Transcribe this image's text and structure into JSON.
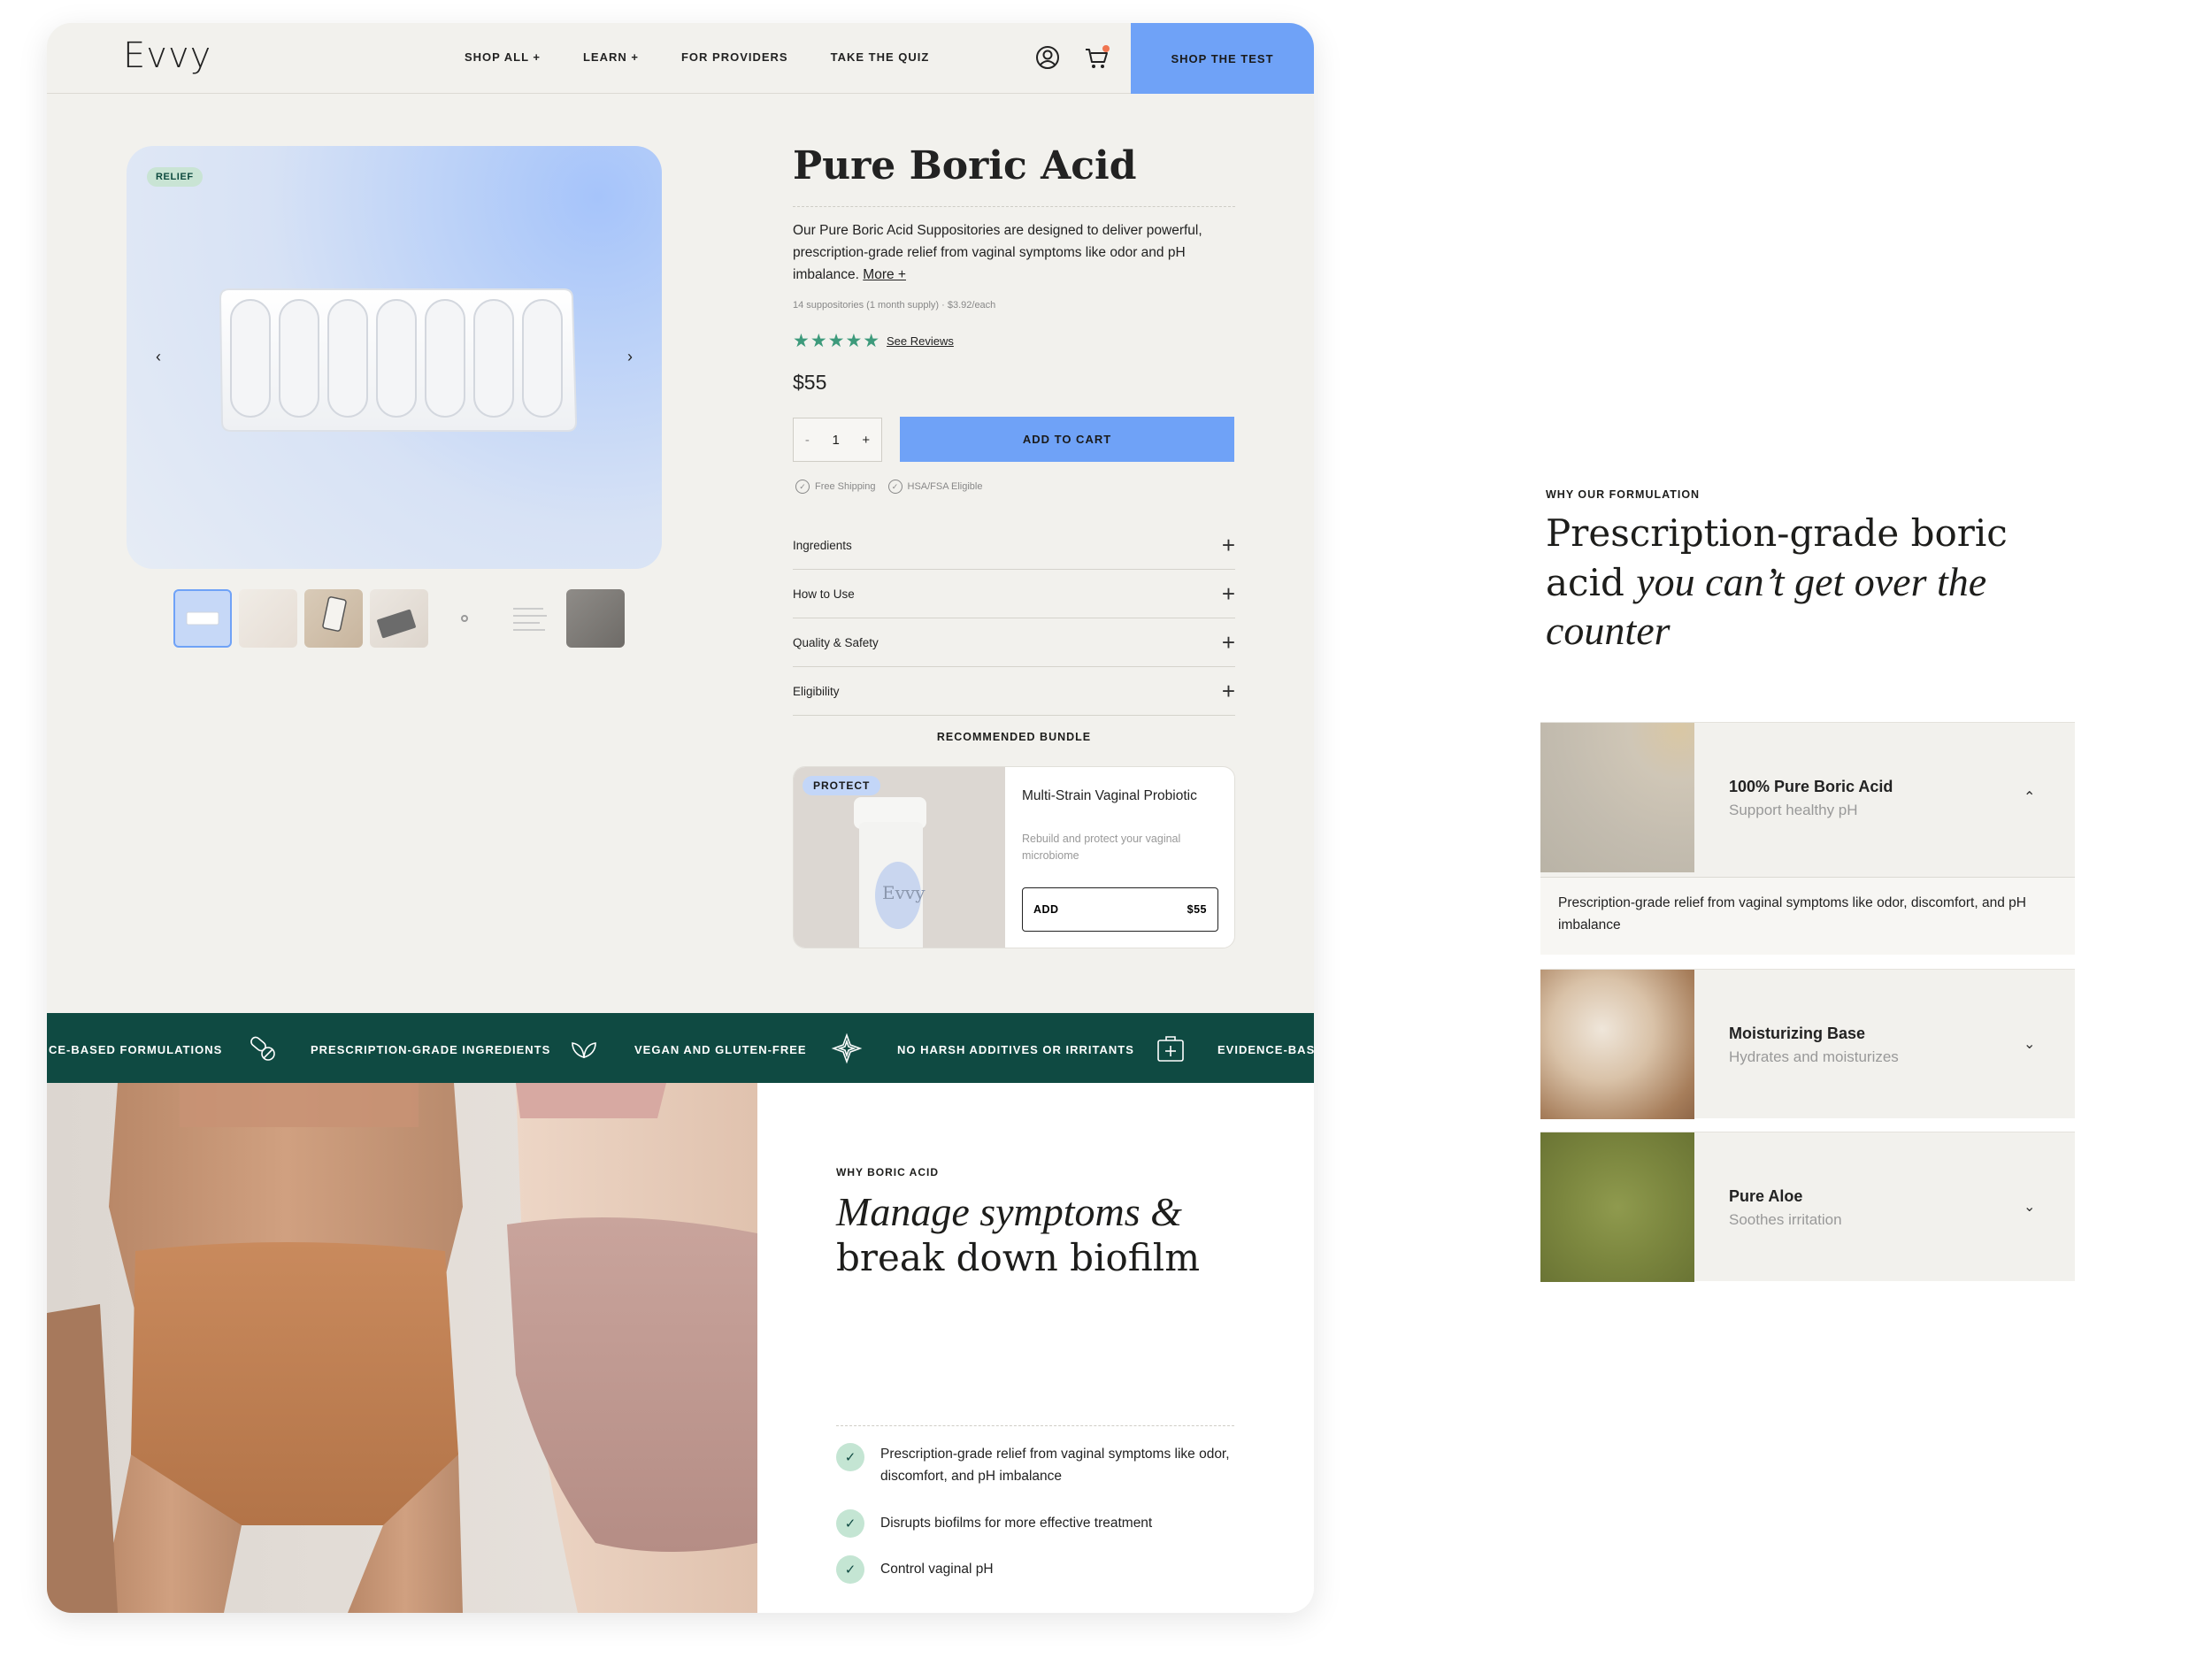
{
  "nav": {
    "logo": "Evvy",
    "links": [
      "SHOP ALL +",
      "LEARN +",
      "FOR PROVIDERS",
      "TAKE THE QUIZ"
    ],
    "cta": "SHOP THE TEST"
  },
  "gallery": {
    "badge": "RELIEF"
  },
  "product": {
    "title": "Pure Boric Acid",
    "description": "Our Pure Boric Acid Suppositories are designed to deliver powerful, prescription-grade relief from vaginal symptoms like odor and pH imbalance.",
    "more_link": "More +",
    "supply": "14 suppositories (1 month supply) · $3.92/each",
    "stars": "★★★★★",
    "rating": 5,
    "reviews_link": "See Reviews",
    "price": "$55",
    "qty_minus": "-",
    "qty_value": "1",
    "qty_plus": "+",
    "add_to_cart": "ADD TO CART",
    "perks": [
      "Free Shipping",
      "HSA/FSA Eligible"
    ]
  },
  "accordion": [
    "Ingredients",
    "How to Use",
    "Quality & Safety",
    "Eligibility"
  ],
  "bundle": {
    "title": "RECOMMENDED BUNDLE",
    "badge": "PROTECT",
    "bottle_label": "Evvy",
    "name": "Multi-Strain Vaginal Probiotic",
    "desc": "Rebuild and protect your vaginal microbiome",
    "add_label": "ADD",
    "add_price": "$55"
  },
  "marquee": [
    "CE-BASED  FORMULATIONS",
    "PRESCRIPTION-GRADE  INGREDIENTS",
    "VEGAN AND  GLUTEN-FREE",
    "NO HARSH ADDITIVES  OR IRRITANTS",
    "EVIDENCE-BASE"
  ],
  "why": {
    "eyebrow": "WHY BORIC ACID",
    "head_italic": "Manage symptoms &",
    "head_regular": "break down biofilm",
    "benefits": [
      "Prescription-grade relief from vaginal symptoms like odor, discomfort, and pH imbalance",
      "Disrupts biofilms for more effective treatment",
      "Control vaginal pH"
    ]
  },
  "formulation": {
    "eyebrow": "WHY OUR FORMULATION",
    "head_line1": "Prescription-grade boric",
    "head_line2_regular": "acid ",
    "head_line2_italic": "you can’t get over the",
    "head_line3_italic": "counter",
    "ingredients": [
      {
        "name": "100% Pure Boric Acid",
        "sub": "Support healthy pH",
        "body": "Prescription-grade relief from vaginal symptoms like odor, discomfort, and pH imbalance",
        "expanded": true
      },
      {
        "name": "Moisturizing Base",
        "sub": "Hydrates and moisturizes",
        "expanded": false
      },
      {
        "name": "Pure Aloe",
        "sub": "Soothes irritation",
        "expanded": false
      }
    ]
  },
  "colors": {
    "blue": "#6fa2f7",
    "green": "#0f4a42",
    "cream": "#f2f1ed",
    "mint": "#c4e5d3"
  }
}
